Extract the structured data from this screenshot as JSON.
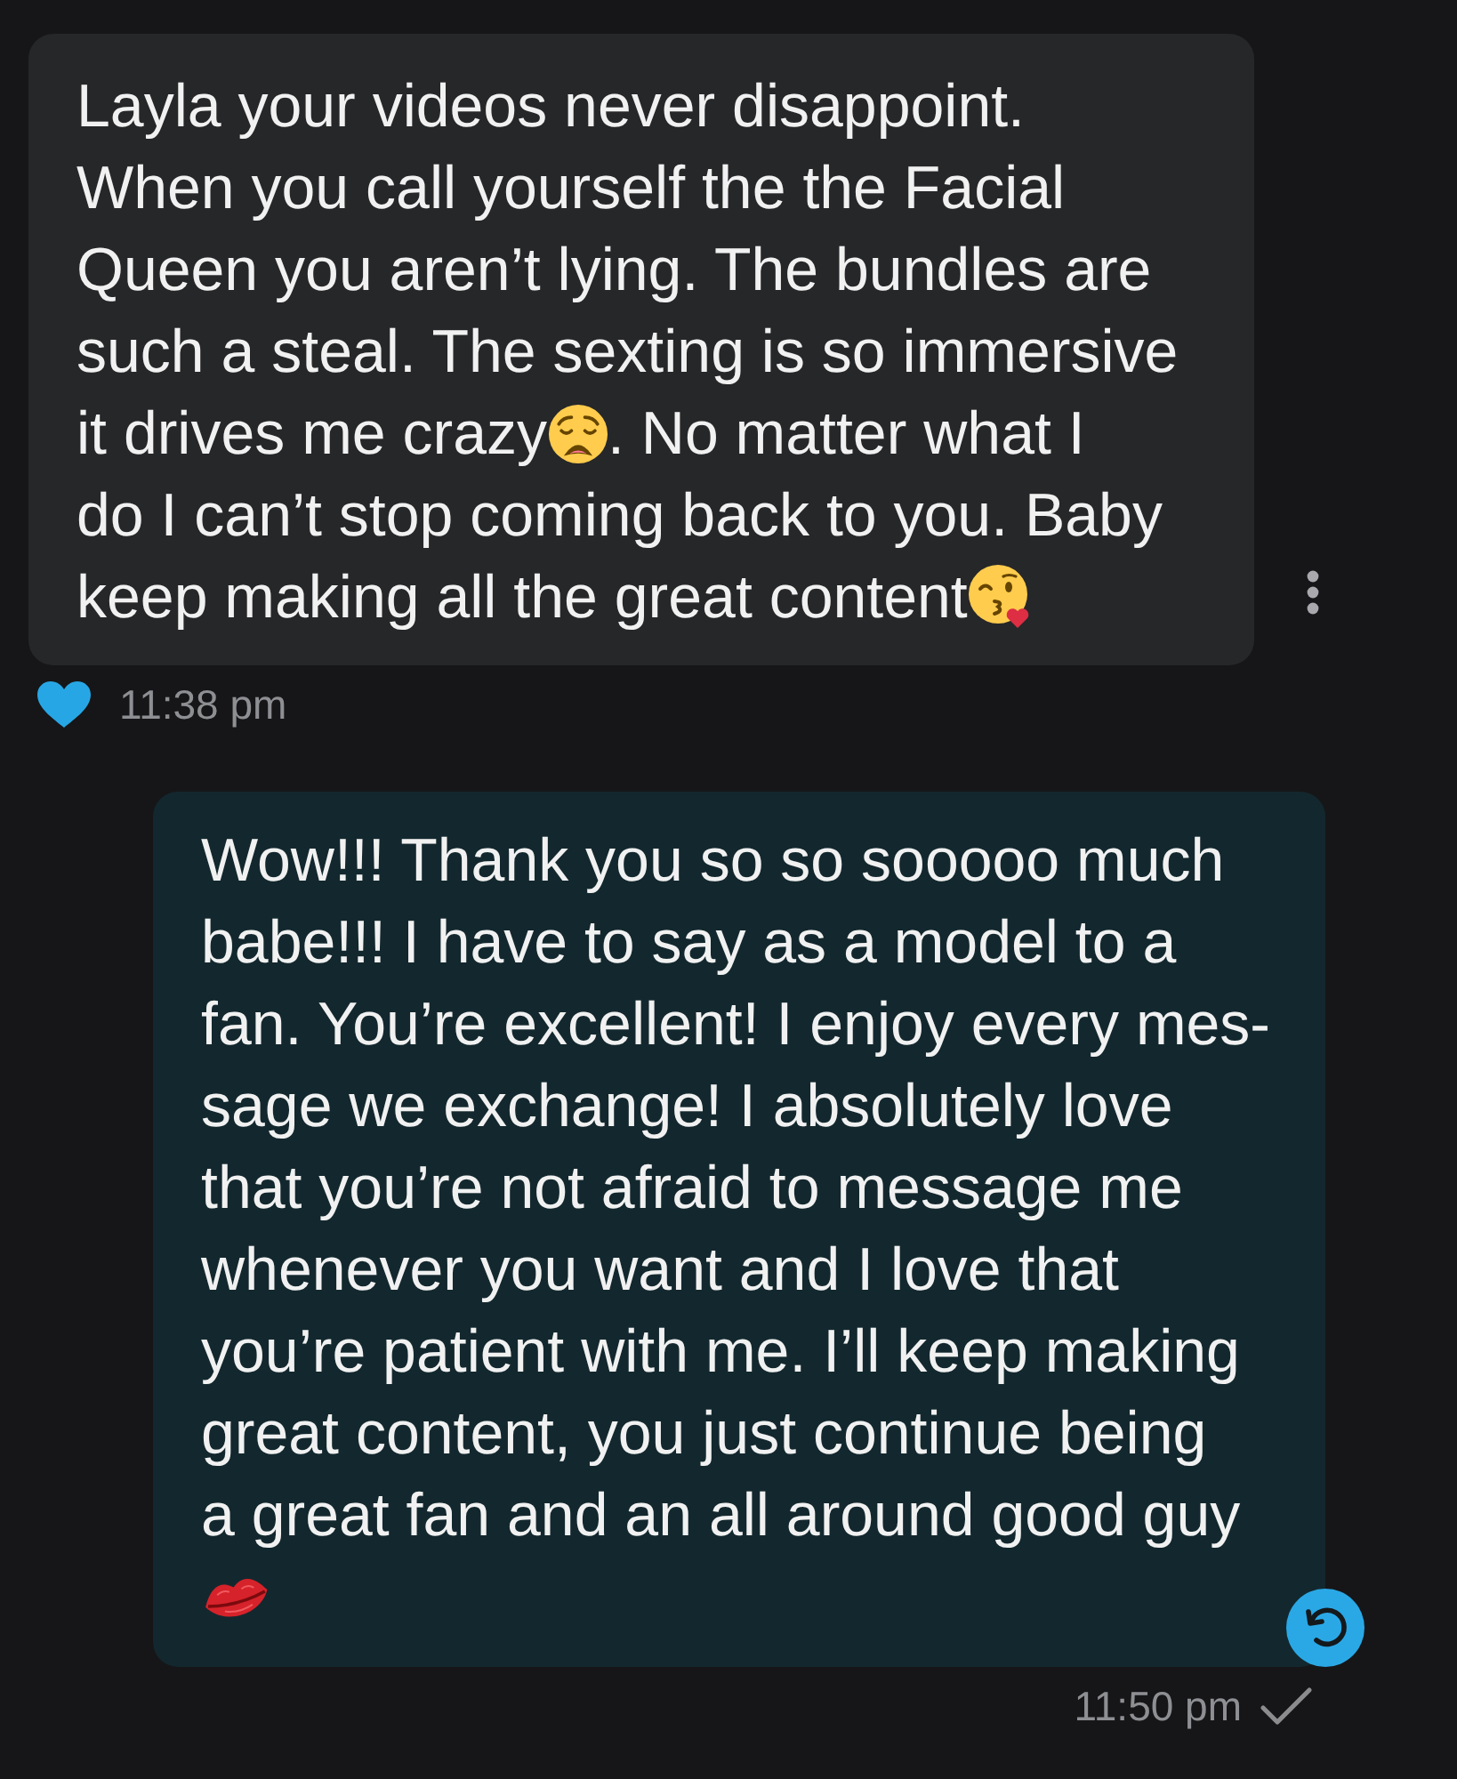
{
  "messages": [
    {
      "outgoing": false,
      "segments": [
        {
          "kind": "text",
          "text": "Layla your videos never disappoint.\nWhen you call yourself the the Facial\nQueen you aren’t lying. The bundles are\nsuch a steal. The sexting is so immersive"
        },
        {
          "kind": "break"
        },
        {
          "kind": "text",
          "text": "it drives me crazy"
        },
        {
          "kind": "weary"
        },
        {
          "kind": "text",
          "text": ". No matter what I"
        },
        {
          "kind": "break"
        },
        {
          "kind": "text",
          "text": "do I can’t stop coming back to you. Baby"
        },
        {
          "kind": "break"
        },
        {
          "kind": "text",
          "text": "keep making all the great content"
        },
        {
          "kind": "kiss"
        }
      ],
      "liked": true,
      "time": "11:38 pm"
    },
    {
      "outgoing": true,
      "segments": [
        {
          "kind": "text",
          "text": "Wow!!! Thank you so so sooooo much\nbabe!!! I have to say as a model to a\nfan. You’re excellent! I enjoy every mes-\nsage we exchange! I absolutely love\nthat you’re not afraid to message me\nwhenever you want and I love that\nyou’re patient with me. I’ll keep making\ngreat content, you just continue being\na great fan and an all around good guy"
        },
        {
          "kind": "break"
        },
        {
          "kind": "lips"
        }
      ],
      "time": "11:50 pm",
      "read": false
    }
  ]
}
